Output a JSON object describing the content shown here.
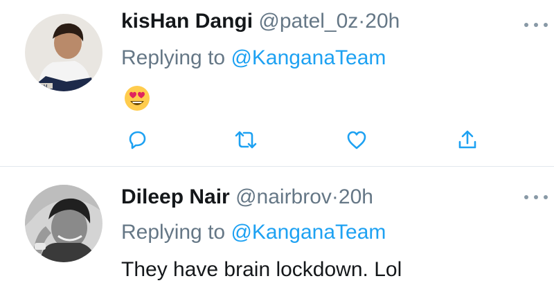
{
  "tweets": [
    {
      "author_name": "kisHan Dangi",
      "handle": "@patel_0z",
      "separator": "·",
      "time": "20h",
      "replying_prefix": "Replying to",
      "replying_to": "@KanganaTeam",
      "content_emoji": "smiling-face-with-heart-eyes",
      "avatar_badge": "NAM"
    },
    {
      "author_name": "Dileep Nair",
      "handle": "@nairbrov",
      "separator": "·",
      "time": "20h",
      "replying_prefix": "Replying to",
      "replying_to": "@KanganaTeam",
      "content_text": "They have brain lockdown. Lol"
    }
  ],
  "actions": [
    "reply-icon",
    "retweet-icon",
    "like-icon",
    "share-icon"
  ],
  "colors": {
    "link": "#1da1f2",
    "secondary": "#657786",
    "text": "#14171a",
    "icon": "#1da1f2",
    "divider": "#e1e8ed"
  }
}
